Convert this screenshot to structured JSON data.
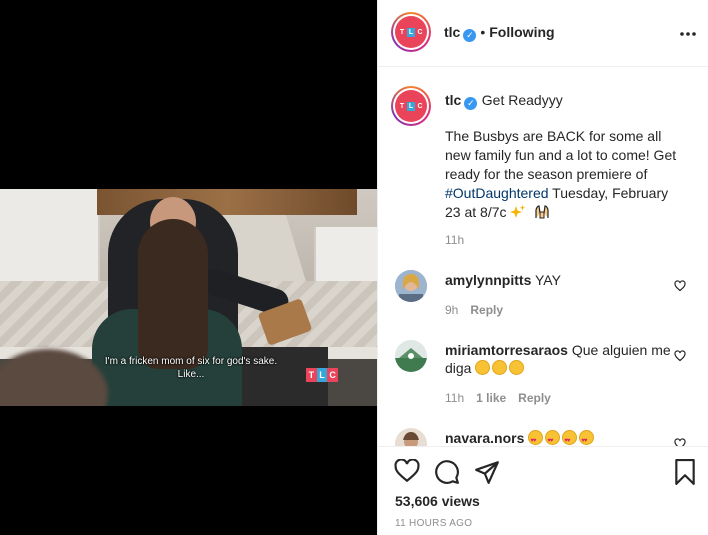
{
  "media": {
    "subtitle": "I'm a fricken mom of six for god's sake. Like...",
    "bug_letters": [
      "T",
      "L",
      "C"
    ]
  },
  "header": {
    "username": "tlc",
    "separator": "•",
    "follow_state": "Following",
    "more_glyph": "•••"
  },
  "post": {
    "username": "tlc",
    "title": "Get Readyyy",
    "body_before": "The Busbys are BACK for some all new family fun and a lot to come! Get ready for the season premiere of ",
    "hashtag": "#OutDaughtered",
    "body_after": " Tuesday, February 23 at 8/7c",
    "age": "11h"
  },
  "comments": [
    {
      "username": "amylynnpitts",
      "text": "YAY",
      "age": "9h",
      "likes": "",
      "reply": "Reply"
    },
    {
      "username": "miriamtorresaraos",
      "text": "Que alguien me diga",
      "age": "11h",
      "likes": "1 like",
      "reply": "Reply"
    },
    {
      "username": "navara.nors",
      "text": "",
      "age": "",
      "likes": "",
      "reply": ""
    }
  ],
  "footer": {
    "views": "53,606 views",
    "timestamp": "11 HOURS AGO"
  },
  "colors": {
    "brand_pink": "#e9445a",
    "link": "#00376b",
    "verified": "#3897f0",
    "muted": "#8e8e8e"
  },
  "icons": [
    "more-icon",
    "verified-icon",
    "heart-icon",
    "comment-icon",
    "share-icon",
    "save-icon",
    "like-comment-icon"
  ]
}
